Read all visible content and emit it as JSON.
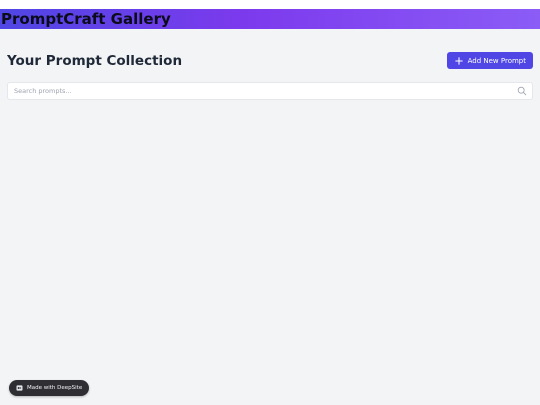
{
  "header": {
    "app_title": "PromptCraft Gallery"
  },
  "toolbar": {
    "page_title": "Your Prompt Collection",
    "add_button_label": "Add New Prompt",
    "add_button_icon": "plus-icon"
  },
  "search": {
    "placeholder": "Search prompts...",
    "value": "",
    "icon": "search-icon"
  },
  "badge": {
    "label": "Made with DeepSite",
    "icon": "deepsite-logo-icon"
  },
  "colors": {
    "header_gradient_start": "#4f46e5",
    "header_gradient_end": "#8b5cf6",
    "accent": "#4f46e5",
    "background": "#f3f4f6",
    "badge_background": "#2f2f33"
  }
}
